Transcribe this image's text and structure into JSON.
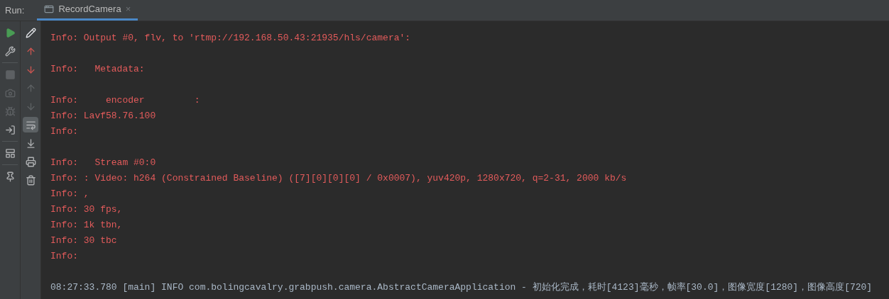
{
  "run_bar": {
    "label": "Run:",
    "tabs": [
      {
        "title": "RecordCamera",
        "close": "×",
        "selected": true
      }
    ]
  },
  "left_toolbar": [
    {
      "disabled": false
    },
    {
      "disabled": false
    },
    {
      "disabled": true
    },
    {
      "disabled": true
    },
    {
      "disabled": true
    },
    {
      "disabled": false
    },
    {
      "disabled": false
    },
    {
      "disabled": false
    }
  ],
  "console_toolbar": [
    {
      "disabled": false,
      "selected": false
    },
    {
      "disabled": false,
      "selected": false
    },
    {
      "disabled": false,
      "selected": false
    },
    {
      "disabled": true,
      "selected": false
    },
    {
      "disabled": true,
      "selected": false
    },
    {
      "disabled": false,
      "selected": true
    },
    {
      "disabled": false,
      "selected": false
    },
    {
      "disabled": false,
      "selected": false
    },
    {
      "disabled": false,
      "selected": false
    }
  ],
  "console": {
    "lines": [
      {
        "kind": "error",
        "text": "Info: Output #0, flv, to 'rtmp://192.168.50.43:21935/hls/camera':"
      },
      {
        "kind": "blank"
      },
      {
        "kind": "error",
        "text": "Info:   Metadata:"
      },
      {
        "kind": "blank"
      },
      {
        "kind": "error",
        "text": "Info:     encoder         :"
      },
      {
        "kind": "error",
        "text": "Info: Lavf58.76.100"
      },
      {
        "kind": "error",
        "text": "Info:"
      },
      {
        "kind": "blank"
      },
      {
        "kind": "error",
        "text": "Info:   Stream #0:0"
      },
      {
        "kind": "error",
        "text": "Info: : Video: h264 (Constrained Baseline) ([7][0][0][0] / 0x0007), yuv420p, 1280x720, q=2-31, 2000 kb/s"
      },
      {
        "kind": "error",
        "text": "Info: ,"
      },
      {
        "kind": "error",
        "text": "Info: 30 fps,"
      },
      {
        "kind": "error",
        "text": "Info: 1k tbn,"
      },
      {
        "kind": "error",
        "text": "Info: 30 tbc"
      },
      {
        "kind": "error",
        "text": "Info:"
      },
      {
        "kind": "blank"
      },
      {
        "kind": "log",
        "text": "08:27:33.780 [main] INFO com.bolingcavalry.grabpush.camera.AbstractCameraApplication - 初始化完成，耗时[4123]毫秒，帧率[30.0]，图像宽度[1280]，图像高度[720]"
      }
    ]
  }
}
